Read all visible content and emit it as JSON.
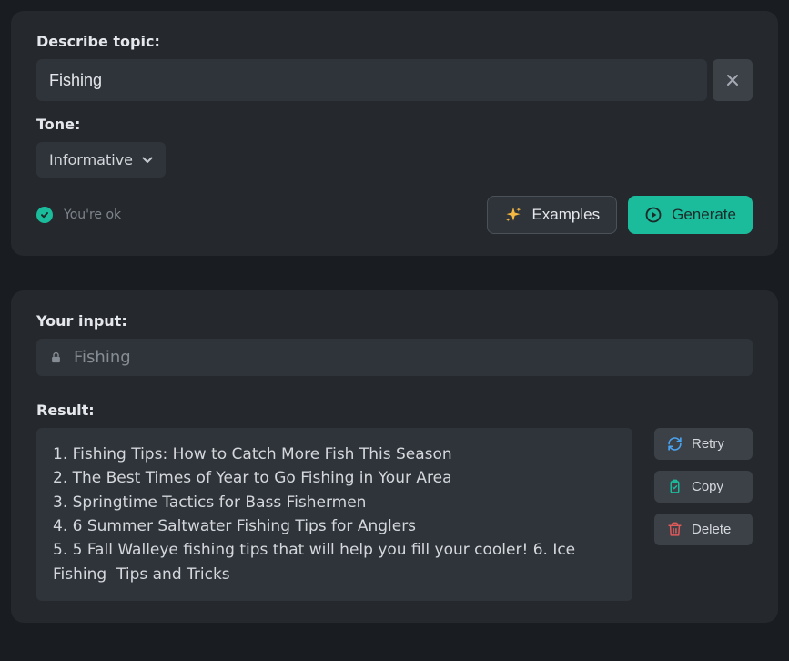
{
  "input_panel": {
    "describe_label": "Describe topic:",
    "describe_value": "Fishing",
    "tone_label": "Tone:",
    "tone_value": "Informative",
    "status_text": "You're ok",
    "examples_label": "Examples",
    "generate_label": "Generate"
  },
  "output_panel": {
    "your_input_label": "Your input:",
    "your_input_value": "Fishing",
    "result_label": "Result:",
    "result_text": "1. Fishing Tips: How to Catch More Fish This Season\n2. The Best Times of Year to Go Fishing in Your Area\n3. Springtime Tactics for Bass Fishermen\n4. 6 Summer Saltwater Fishing Tips for Anglers\n5. 5 Fall Walleye fishing tips that will help you fill your cooler! 6. Ice Fishing  Tips and Tricks",
    "retry_label": "Retry",
    "copy_label": "Copy",
    "delete_label": "Delete"
  },
  "colors": {
    "accent": "#1ABC9C",
    "sparkle": "#F5B942",
    "retry_icon": "#4AA3F0",
    "copy_icon": "#1ABC9C",
    "delete_icon": "#E05A5A"
  }
}
